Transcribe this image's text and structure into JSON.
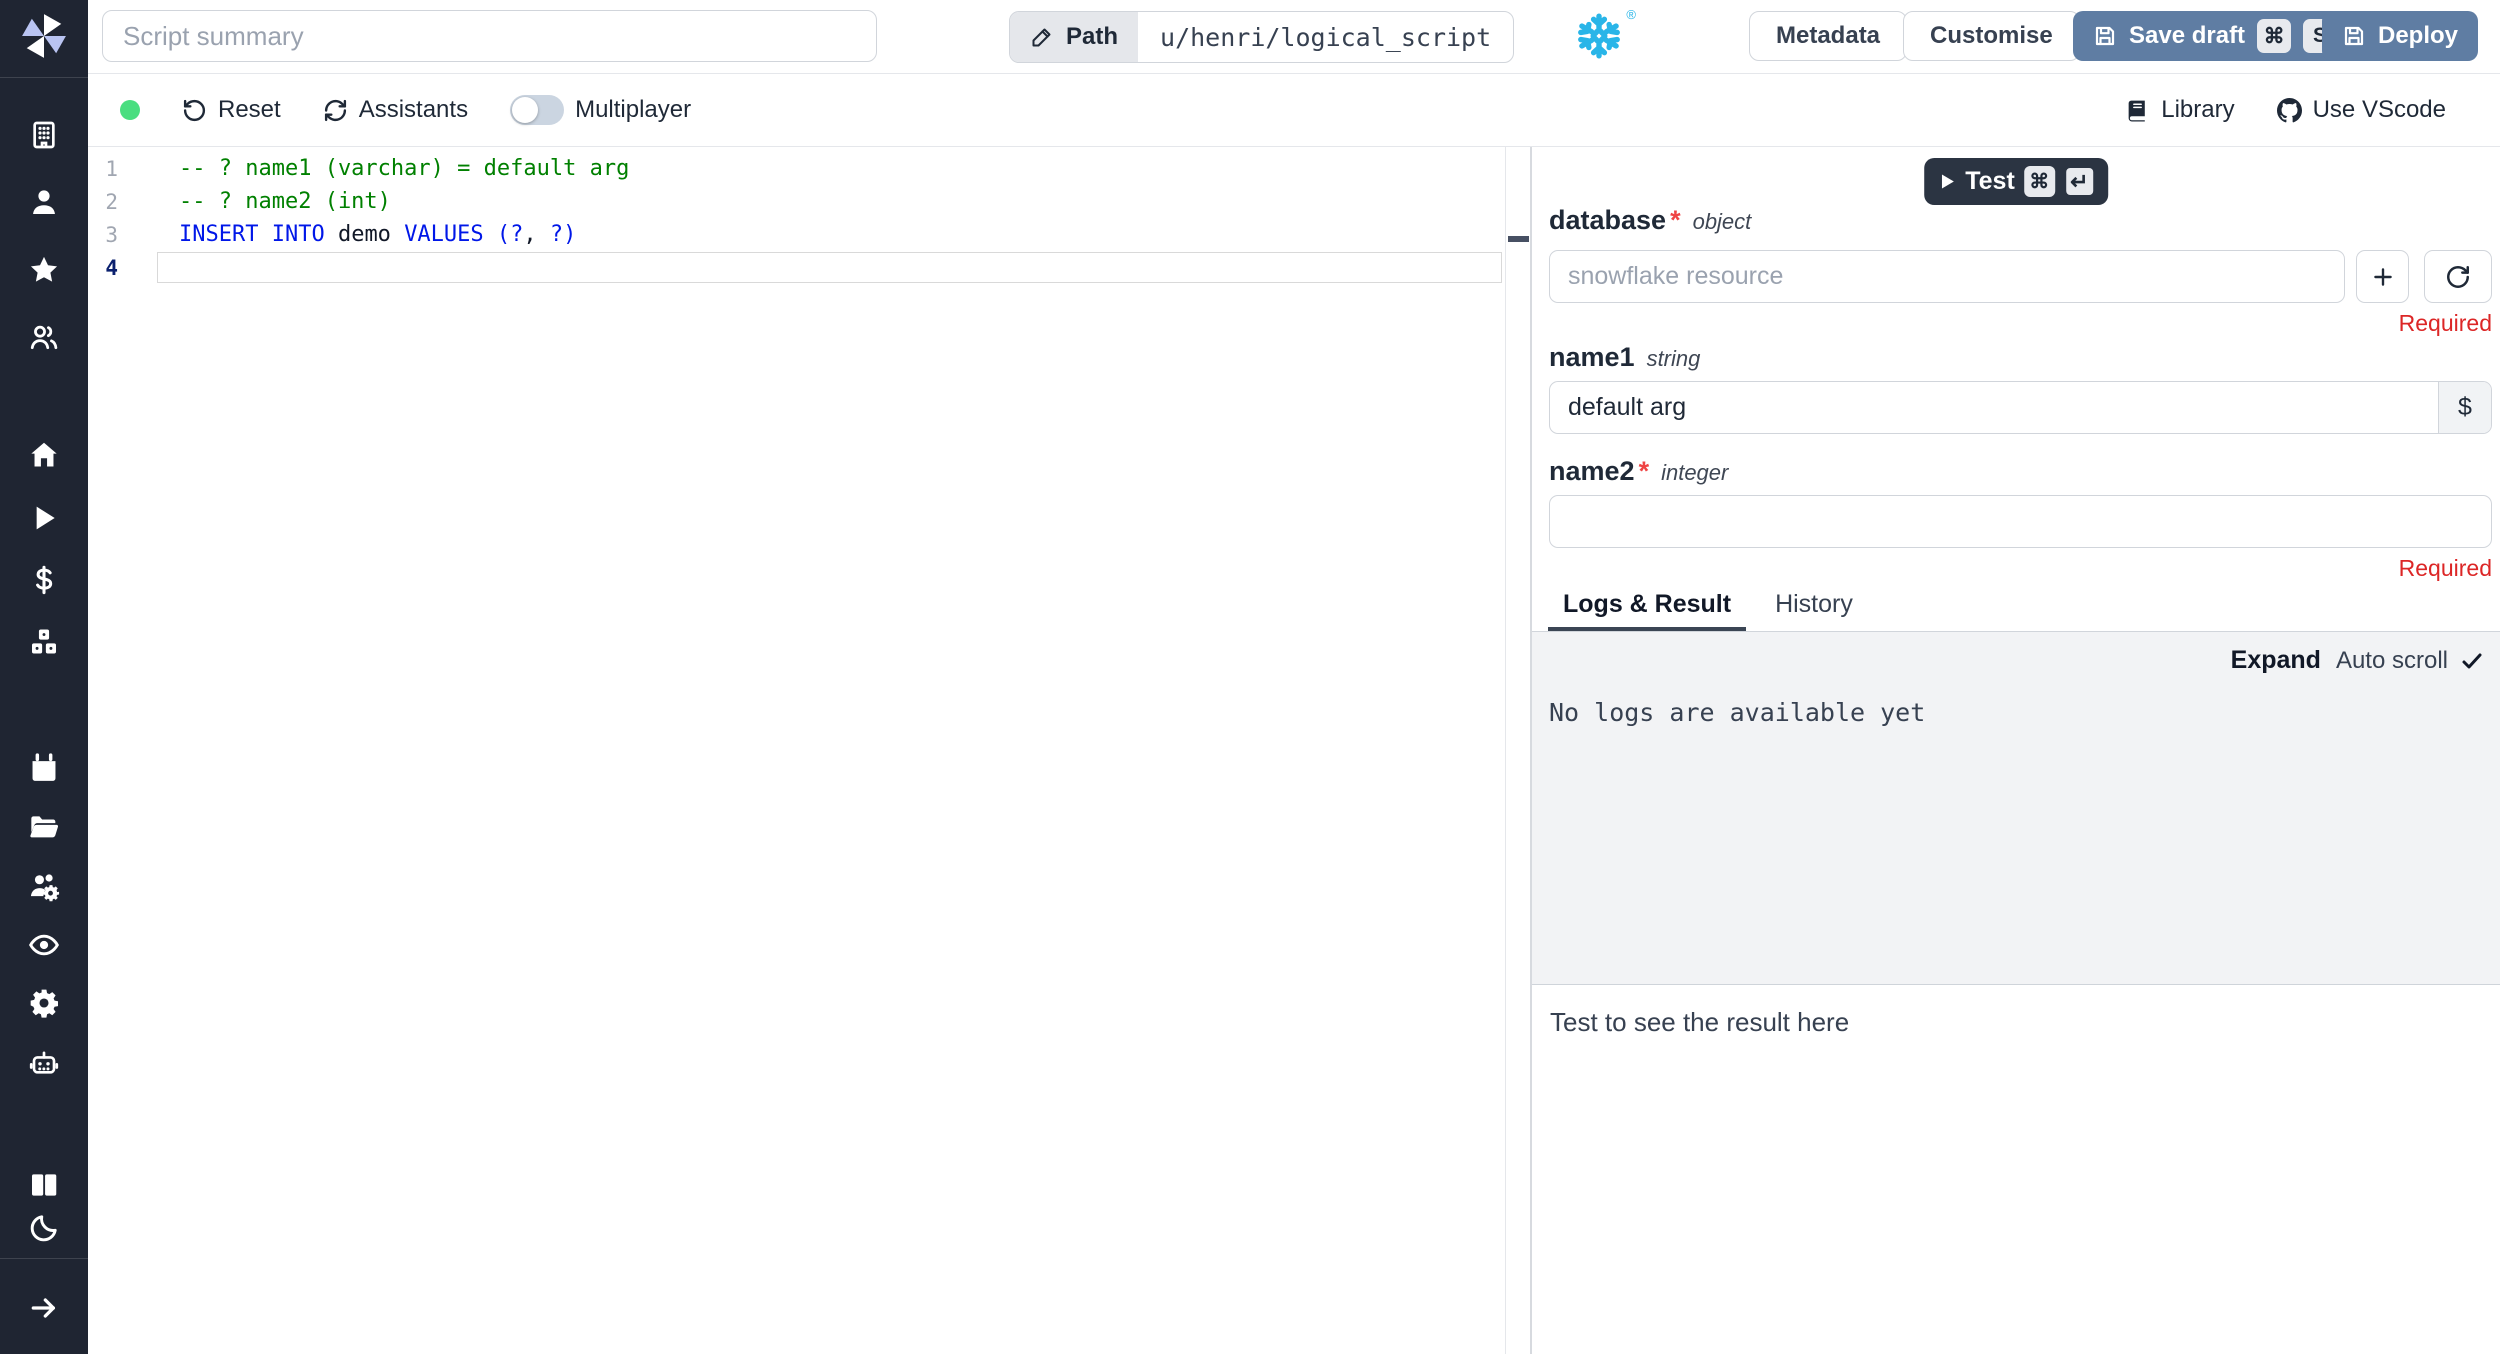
{
  "topbar": {
    "summary_placeholder": "Script summary",
    "path_label": "Path",
    "path_value": "u/henri/logical_script",
    "language": "snowflake",
    "logo_reg": "®",
    "metadata_label": "Metadata",
    "customise_label": "Customise",
    "save_draft_label": "Save draft",
    "save_draft_keys": [
      "⌘",
      "S"
    ],
    "deploy_label": "Deploy"
  },
  "toolbar": {
    "reset_label": "Reset",
    "assistants_label": "Assistants",
    "multiplayer_label": "Multiplayer",
    "multiplayer_on": false,
    "library_label": "Library",
    "vscode_label": "Use VScode"
  },
  "sidebar": {
    "items": [
      {
        "id": "workspace",
        "icon": "building-icon"
      },
      {
        "id": "user",
        "icon": "user-icon"
      },
      {
        "id": "favorites",
        "icon": "star-icon"
      },
      {
        "id": "users",
        "icon": "users-icon"
      },
      {
        "id": "home",
        "icon": "home-icon"
      },
      {
        "id": "runs",
        "icon": "play-icon"
      },
      {
        "id": "variables",
        "icon": "dollar-icon"
      },
      {
        "id": "resources",
        "icon": "boxes-icon"
      },
      {
        "id": "schedules",
        "icon": "calendar-icon"
      },
      {
        "id": "folders",
        "icon": "folder-open-icon"
      },
      {
        "id": "groups",
        "icon": "users-gear-icon"
      },
      {
        "id": "audit-logs",
        "icon": "eye-icon"
      },
      {
        "id": "settings",
        "icon": "gear-icon"
      },
      {
        "id": "workers",
        "icon": "robot-icon"
      },
      {
        "id": "docs",
        "icon": "books-icon"
      },
      {
        "id": "dark-mode",
        "icon": "moon-icon"
      },
      {
        "id": "expand-sidebar",
        "icon": "arrow-right-icon"
      }
    ]
  },
  "editor": {
    "colors": {
      "comment": "#008000",
      "keyword": "#0017e8",
      "plain": "#111827"
    },
    "lines": [
      {
        "number": "1",
        "active": false,
        "tokens": [
          {
            "t": "-- ? name1 (varchar) = default arg",
            "c": "comment"
          }
        ]
      },
      {
        "number": "2",
        "active": false,
        "tokens": [
          {
            "t": "-- ? name2 (int)",
            "c": "comment"
          }
        ]
      },
      {
        "number": "3",
        "active": false,
        "tokens": [
          {
            "t": "INSERT INTO",
            "c": "keyword"
          },
          {
            "t": " demo ",
            "c": "plain"
          },
          {
            "t": "VALUES",
            "c": "keyword"
          },
          {
            "t": " ",
            "c": "plain"
          },
          {
            "t": "(?",
            "c": "keyword"
          },
          {
            "t": ",",
            "c": "plain"
          },
          {
            "t": " ?)",
            "c": "keyword"
          }
        ]
      },
      {
        "number": "4",
        "active": true,
        "tokens": []
      }
    ]
  },
  "form": {
    "test_label": "Test",
    "test_keys": [
      "⌘",
      "↵"
    ],
    "required_star": "*",
    "required_msg": "Required",
    "fields": {
      "database": {
        "label": "database",
        "type": "object",
        "required": true,
        "placeholder": "snowflake resource",
        "value": ""
      },
      "name1": {
        "label": "name1",
        "type": "string",
        "required": false,
        "value": "default arg",
        "addon": "$"
      },
      "name2": {
        "label": "name2",
        "type": "integer",
        "required": true,
        "value": ""
      }
    }
  },
  "results": {
    "tabs": [
      "Logs & Result",
      "History"
    ],
    "active_tab": "Logs & Result",
    "expand_label": "Expand",
    "autoscroll_label": "Auto scroll",
    "autoscroll_checked": true,
    "no_logs_message": "No logs are available yet",
    "result_placeholder": "Test to see the result here"
  }
}
